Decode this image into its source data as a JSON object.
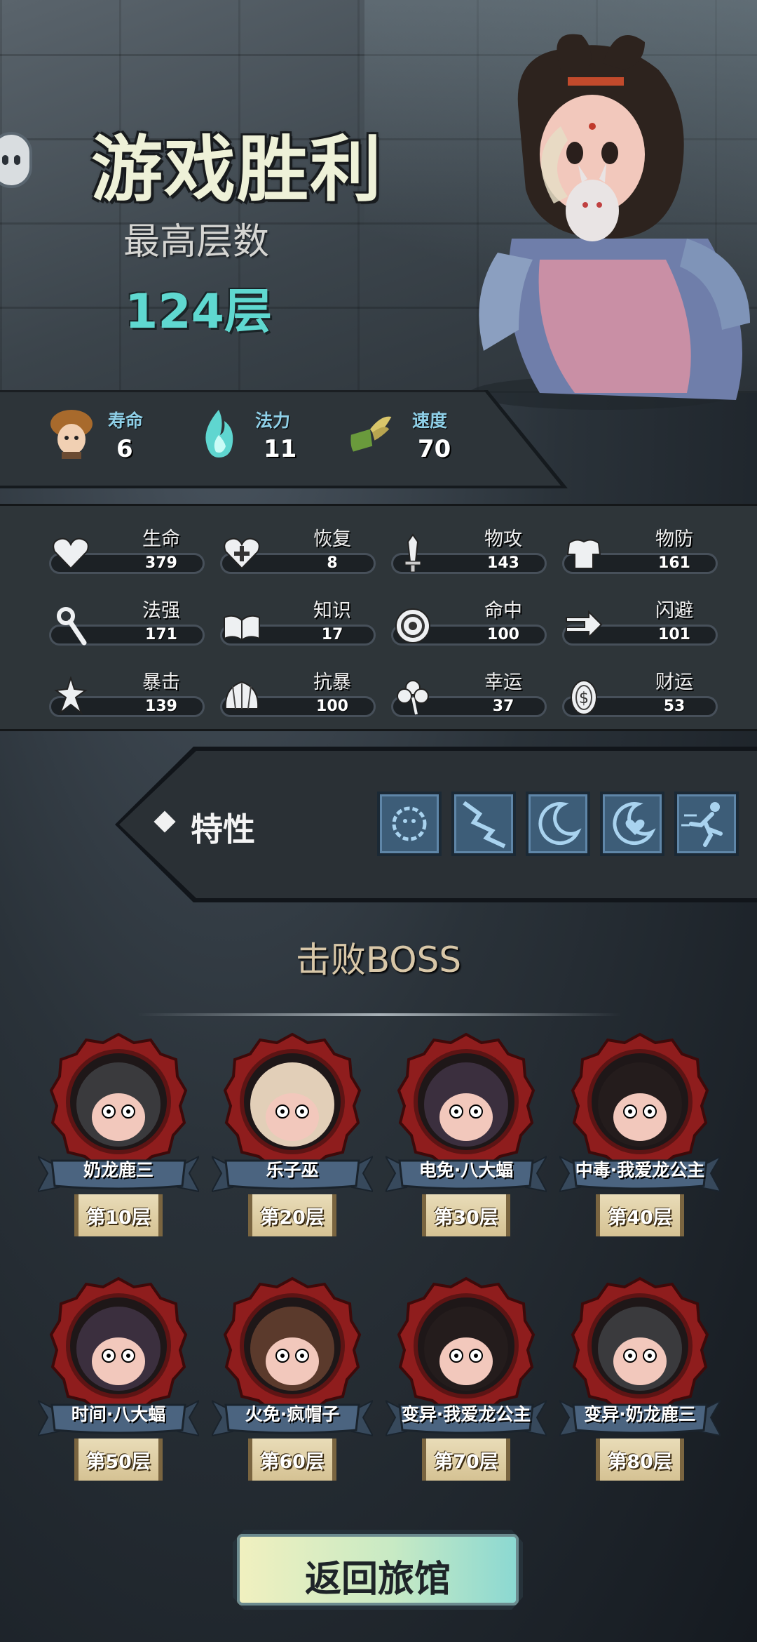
{
  "header": {
    "title": "游戏胜利",
    "max_floor_label": "最高层数",
    "max_floor_value": "124层"
  },
  "attributes": [
    {
      "label": "寿命",
      "value": "6",
      "icon": "mushroom-head-icon"
    },
    {
      "label": "法力",
      "value": "11",
      "icon": "blue-flame-icon"
    },
    {
      "label": "速度",
      "value": "70",
      "icon": "winged-boot-icon"
    }
  ],
  "stats": [
    {
      "name": "生命",
      "value": "379",
      "icon": "heart-icon"
    },
    {
      "name": "恢复",
      "value": "8",
      "icon": "heart-plus-icon"
    },
    {
      "name": "物攻",
      "value": "143",
      "icon": "sword-icon"
    },
    {
      "name": "物防",
      "value": "161",
      "icon": "armor-icon"
    },
    {
      "name": "法强",
      "value": "171",
      "icon": "staff-icon"
    },
    {
      "name": "知识",
      "value": "17",
      "icon": "book-icon"
    },
    {
      "name": "命中",
      "value": "100",
      "icon": "target-icon"
    },
    {
      "name": "闪避",
      "value": "101",
      "icon": "dash-arrow-icon"
    },
    {
      "name": "暴击",
      "value": "139",
      "icon": "crit-blade-icon"
    },
    {
      "name": "抗暴",
      "value": "100",
      "icon": "shell-shield-icon"
    },
    {
      "name": "幸运",
      "value": "37",
      "icon": "clover-icon"
    },
    {
      "name": "财运",
      "value": "53",
      "icon": "coin-icon"
    }
  ],
  "traits": {
    "label": "特性",
    "icons": [
      "spiky-blob-icon",
      "crack-icon",
      "moon-icon",
      "heart-moon-icon",
      "running-figure-icon"
    ]
  },
  "bosses": {
    "title": "击败BOSS",
    "items": [
      {
        "name": "奶龙鹿三",
        "floor": "第10层",
        "color": "#3a3a3d"
      },
      {
        "name": "乐子巫",
        "floor": "第20层",
        "color": "#e2cfb8"
      },
      {
        "name": "电免·八大蝠",
        "floor": "第30层",
        "color": "#3b2f3e"
      },
      {
        "name": "中毒·我爱龙公主",
        "floor": "第40层",
        "color": "#241c1c"
      },
      {
        "name": "时间·八大蝠",
        "floor": "第50层",
        "color": "#3b2f3e"
      },
      {
        "name": "火免·疯帽子",
        "floor": "第60层",
        "color": "#5b3a2c"
      },
      {
        "name": "变异·我爱龙公主",
        "floor": "第70层",
        "color": "#241c1c"
      },
      {
        "name": "变异·奶龙鹿三",
        "floor": "第80层",
        "color": "#3a3a3d"
      }
    ]
  },
  "return_button": {
    "label": "返回旅馆"
  }
}
